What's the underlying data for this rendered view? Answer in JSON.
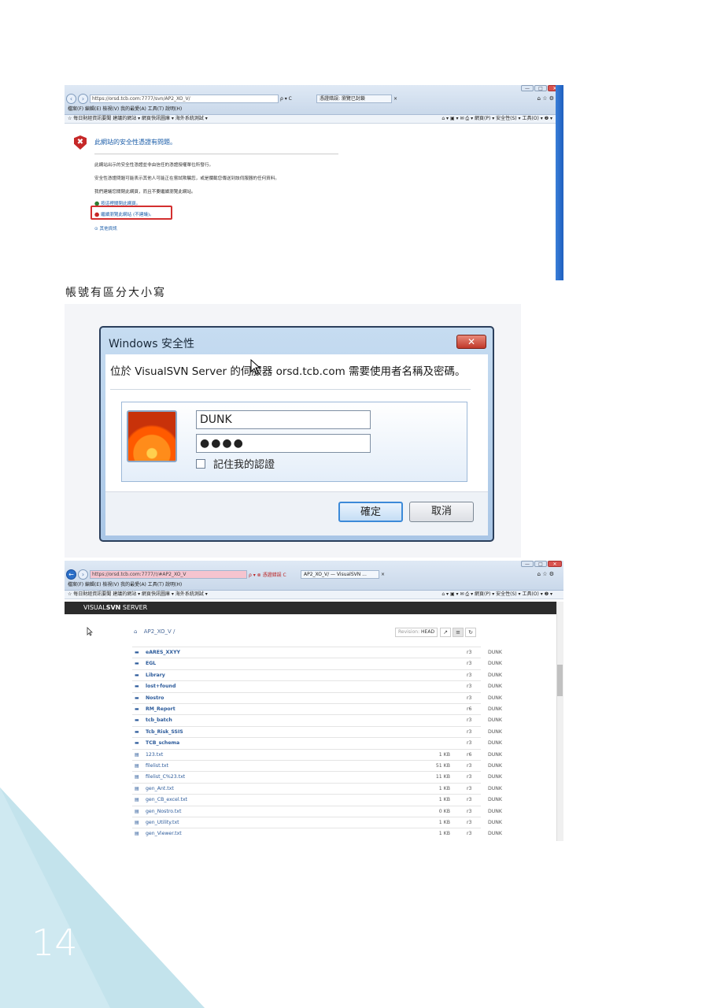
{
  "page_number": "14",
  "caption": "帳號有區分大小寫",
  "shot1": {
    "win_buttons": [
      "—",
      "□",
      "✕"
    ],
    "back_icon": "‹",
    "forward_icon": "›",
    "address": "https://orsd.tcb.com:7777/svn/AP2_XO_V/",
    "search_glyph": "ρ ▾ C",
    "tab_title": "憑證錯誤: 瀏覽已封鎖",
    "tab_close": "×",
    "chrome_right": "⌂ ☆ ⚙",
    "menu": "檔案(F)   編輯(E)   檢視(V)   我的最愛(A)   工具(T)   說明(H)",
    "favorites": "☆  每日財經資訊要聞   建議的網站 ▾   網頁快訊圖庫 ▾   海外系統測試 ▾",
    "toolbar_right": "⌂ ▾  ▣ ▾  ✉  ⎙ ▾  網頁(P) ▾  安全性(S) ▾  工具(O) ▾  ❷ ▾",
    "warn_glyph": "✖",
    "title": "此網站的安全性憑證有問題。",
    "p1": "此網站出示的安全性憑證並非由信任的憑證授權單位所發行。",
    "p2": "安全性憑證問題可能表示其他人可能正在嘗試欺騙您，或是攔截您傳送到該伺服器的任何資料。",
    "p3": "我們建議您關閉此網頁，而且不要繼續瀏覽此網站。",
    "link1": "按這裡關閉此網頁。",
    "link2": "繼續瀏覽此網站 (不建議)。",
    "link3": "其他資訊",
    "link1_icon": "⬤",
    "link2_icon": "⬤",
    "link3_icon": "⊙"
  },
  "dialog": {
    "title": "Windows 安全性",
    "close": "✕",
    "message": "位於 VisualSVN Server 的伺服器 orsd.tcb.com 需要使用者名稱及密碼。",
    "username": "DUNK",
    "password": "●●●●",
    "remember": "記住我的認證",
    "ok": "確定",
    "cancel": "取消"
  },
  "shot3": {
    "win_buttons": [
      "—",
      "□",
      "✕"
    ],
    "back_icon": "←",
    "forward_icon": "›",
    "address": "https://orsd.tcb.com:7777/!/#AP2_XO_V",
    "cert_glyph": "ρ ▾ ⊗ 憑證錯誤 C",
    "tab_title": "AP2_XO_V/ — VisualSVN ...",
    "tab_close": "×",
    "chrome_right": "⌂ ☆ ⚙",
    "menu": "檔案(F)   編輯(E)   檢視(V)   我的最愛(A)   工具(T)   說明(H)",
    "favorites": "☆  每日財經資訊要聞   建議的網站 ▾   網頁快訊圖庫 ▾   海外系統測試 ▾",
    "toolbar_right": "⌂ ▾  ▣ ▾  ✉  ⎙ ▾  網頁(P) ▾  安全性(S) ▾  工具(O) ▾  ❷ ▾",
    "brand_prefix": "VISUAL",
    "brand_bold": "SVN",
    "brand_suffix": " SERVER",
    "home_icon": "⌂",
    "breadcrumb": "AP2_XO_V /",
    "revision_label": "Revision:",
    "revision_value": "HEAD",
    "btn_link": "↗",
    "btn_list": "≡",
    "btn_refresh": "↻",
    "folder_glyph": "▬",
    "file_glyph": "▤",
    "rows": [
      {
        "name": "eARES_XXYY",
        "size": "",
        "rev": "r3",
        "author": "DUNK",
        "dir": true
      },
      {
        "name": "EGL",
        "size": "",
        "rev": "r3",
        "author": "DUNK",
        "dir": true
      },
      {
        "name": "Library",
        "size": "",
        "rev": "r3",
        "author": "DUNK",
        "dir": true
      },
      {
        "name": "lost+found",
        "size": "",
        "rev": "r3",
        "author": "DUNK",
        "dir": true
      },
      {
        "name": "Nostro",
        "size": "",
        "rev": "r3",
        "author": "DUNK",
        "dir": true
      },
      {
        "name": "RM_Report",
        "size": "",
        "rev": "r6",
        "author": "DUNK",
        "dir": true
      },
      {
        "name": "tcb_batch",
        "size": "",
        "rev": "r3",
        "author": "DUNK",
        "dir": true
      },
      {
        "name": "Tcb_Risk_SSIS",
        "size": "",
        "rev": "r3",
        "author": "DUNK",
        "dir": true
      },
      {
        "name": "TCB_schema",
        "size": "",
        "rev": "r3",
        "author": "DUNK",
        "dir": true
      },
      {
        "name": "123.txt",
        "size": "1 KB",
        "rev": "r6",
        "author": "DUNK",
        "dir": false
      },
      {
        "name": "filelist.txt",
        "size": "51 KB",
        "rev": "r3",
        "author": "DUNK",
        "dir": false
      },
      {
        "name": "filelist_C%23.txt",
        "size": "11 KB",
        "rev": "r3",
        "author": "DUNK",
        "dir": false
      },
      {
        "name": "gen_Ant.txt",
        "size": "1 KB",
        "rev": "r3",
        "author": "DUNK",
        "dir": false
      },
      {
        "name": "gen_CB_excel.txt",
        "size": "1 KB",
        "rev": "r3",
        "author": "DUNK",
        "dir": false
      },
      {
        "name": "gen_Nostro.txt",
        "size": "0 KB",
        "rev": "r3",
        "author": "DUNK",
        "dir": false
      },
      {
        "name": "gen_Utility.txt",
        "size": "1 KB",
        "rev": "r3",
        "author": "DUNK",
        "dir": false
      },
      {
        "name": "gen_Viewer.txt",
        "size": "1 KB",
        "rev": "r3",
        "author": "DUNK",
        "dir": false
      }
    ]
  },
  "colors": {
    "corner": "#cfe9f1",
    "corner_dark": "#bfe0ea",
    "link": "#2b5a9a",
    "warn_red": "#c62828"
  }
}
